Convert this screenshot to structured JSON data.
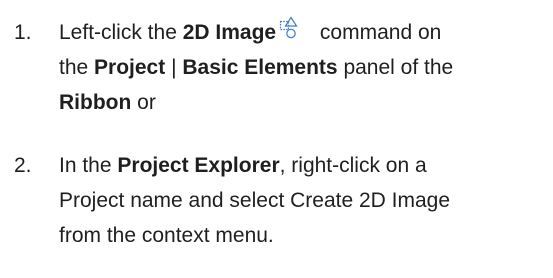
{
  "steps": [
    {
      "number": "1.",
      "line1": {
        "pre": "Left-click the ",
        "bold": "2D Image",
        "post": " command on"
      },
      "line2": {
        "pre": "the ",
        "bold1": "Project",
        "sep": " | ",
        "bold2": "Basic Elements",
        "post": " panel of the"
      },
      "line3": {
        "bold": "Ribbon",
        "post": " or"
      },
      "icon": "2d-image-icon"
    },
    {
      "number": "2.",
      "line1": {
        "pre": "In the ",
        "bold": "Project Explorer",
        "post": ", right-click on a"
      },
      "line2": {
        "text": "Project name and select Create 2D Image"
      },
      "line3": {
        "text": "from the context menu."
      }
    }
  ],
  "colors": {
    "text": "#1f1f1f",
    "icon_stroke": "#3c7bc6"
  }
}
